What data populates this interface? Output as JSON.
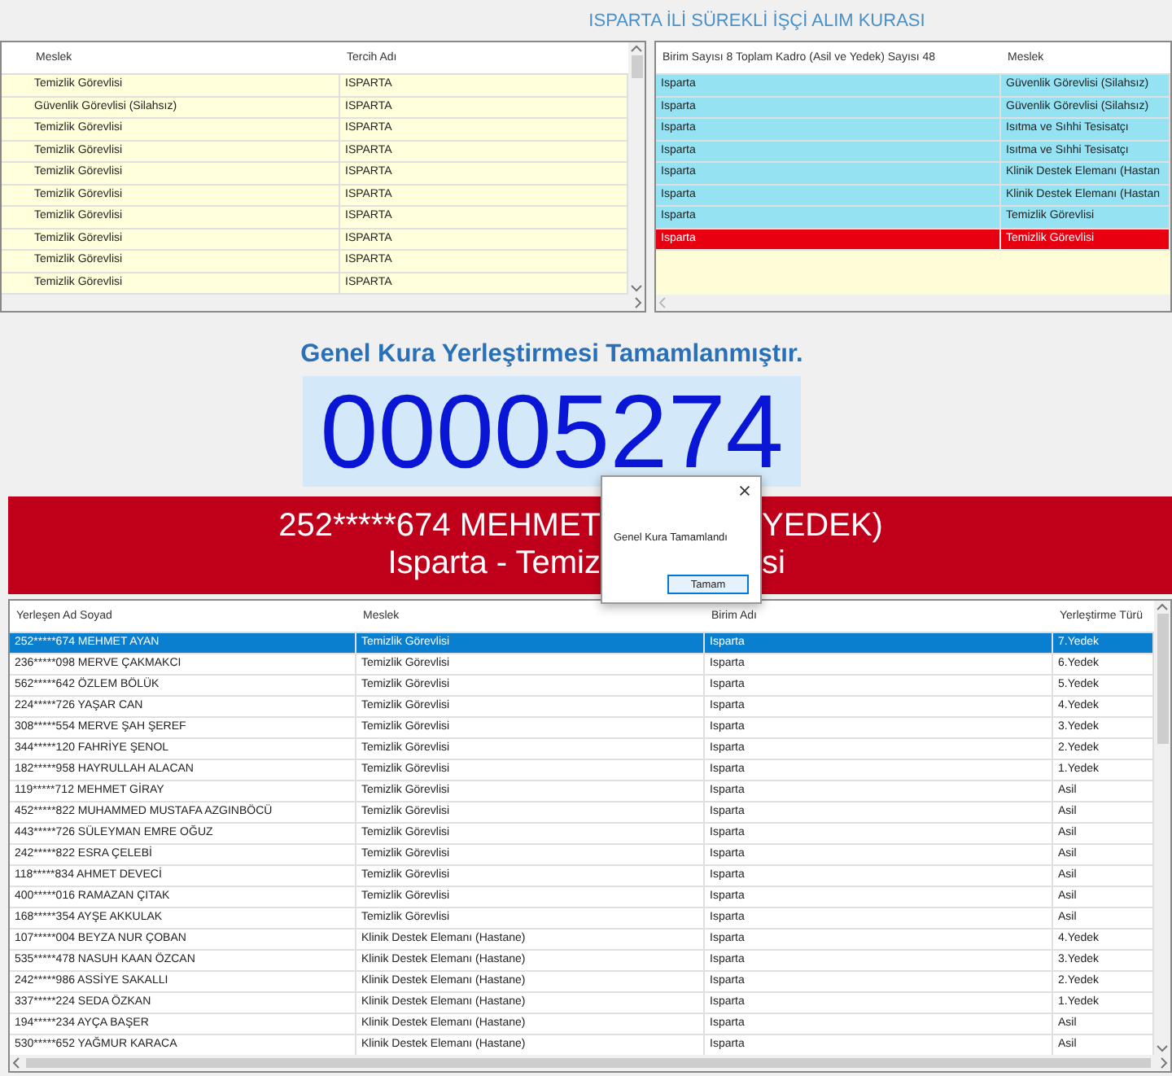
{
  "title": "ISPARTA İLİ SÜREKLİ İŞÇİ ALIM KURASI",
  "preferences_table": {
    "columns": [
      "Meslek",
      "Tercih Adı"
    ],
    "rows": [
      [
        "Temizlik Görevlisi",
        "ISPARTA"
      ],
      [
        "Güvenlik Görevlisi (Silahsız)",
        "ISPARTA"
      ],
      [
        "Temizlik Görevlisi",
        "ISPARTA"
      ],
      [
        "Temizlik Görevlisi",
        "ISPARTA"
      ],
      [
        "Temizlik Görevlisi",
        "ISPARTA"
      ],
      [
        "Temizlik Görevlisi",
        "ISPARTA"
      ],
      [
        "Temizlik Görevlisi",
        "ISPARTA"
      ],
      [
        "Temizlik Görevlisi",
        "ISPARTA"
      ],
      [
        "Temizlik Görevlisi",
        "ISPARTA"
      ],
      [
        "Temizlik Görevlisi",
        "ISPARTA"
      ]
    ]
  },
  "units_table": {
    "columns": [
      "Birim Sayısı 8 Toplam Kadro (Asil ve Yedek) Sayısı 48",
      "Meslek"
    ],
    "rows": [
      {
        "cells": [
          "Isparta",
          "Güvenlik Görevlisi (Silahsız)"
        ],
        "highlighted": false
      },
      {
        "cells": [
          "Isparta",
          "Güvenlik Görevlisi (Silahsız)"
        ],
        "highlighted": false
      },
      {
        "cells": [
          "Isparta",
          "Isıtma ve Sıhhi Tesisatçı"
        ],
        "highlighted": false
      },
      {
        "cells": [
          "Isparta",
          "Isıtma ve Sıhhi Tesisatçı"
        ],
        "highlighted": false
      },
      {
        "cells": [
          "Isparta",
          "Klinik Destek Elemanı (Hastan"
        ],
        "highlighted": false
      },
      {
        "cells": [
          "Isparta",
          "Klinik Destek Elemanı (Hastan"
        ],
        "highlighted": false
      },
      {
        "cells": [
          "Isparta",
          "Temizlik Görevlisi"
        ],
        "highlighted": false
      },
      {
        "cells": [
          "Isparta",
          "Temizlik Görevlisi"
        ],
        "highlighted": true
      }
    ]
  },
  "status": {
    "heading": "Genel Kura Yerleştirmesi Tamamlanmıştır.",
    "number": "00005274",
    "banner_lines": [
      [
        "252*****674 MEHMET",
        "YEDEK)"
      ],
      [
        "Isparta - Temiz",
        "si"
      ]
    ]
  },
  "dialog": {
    "message": "Genel Kura Tamamlandı",
    "button": "Tamam"
  },
  "results_table": {
    "columns": [
      "Yerleşen Ad Soyad",
      "Meslek",
      "Birim Adı",
      "Yerleştirme Türü"
    ],
    "rows": [
      {
        "cells": [
          "252*****674 MEHMET AYAN",
          "Temizlik Görevlisi",
          "Isparta",
          "7.Yedek"
        ],
        "selected": true
      },
      {
        "cells": [
          "236*****098 MERVE ÇAKMAKCI",
          "Temizlik Görevlisi",
          "Isparta",
          "6.Yedek"
        ],
        "selected": false
      },
      {
        "cells": [
          "562*****642 ÖZLEM BÖLÜK",
          "Temizlik Görevlisi",
          "Isparta",
          "5.Yedek"
        ],
        "selected": false
      },
      {
        "cells": [
          "224*****726 YAŞAR CAN",
          "Temizlik Görevlisi",
          "Isparta",
          "4.Yedek"
        ],
        "selected": false
      },
      {
        "cells": [
          "308*****554 MERVE ŞAH ŞEREF",
          "Temizlik Görevlisi",
          "Isparta",
          "3.Yedek"
        ],
        "selected": false
      },
      {
        "cells": [
          "344*****120 FAHRİYE ŞENOL",
          "Temizlik Görevlisi",
          "Isparta",
          "2.Yedek"
        ],
        "selected": false
      },
      {
        "cells": [
          "182*****958 HAYRULLAH ALACAN",
          "Temizlik Görevlisi",
          "Isparta",
          "1.Yedek"
        ],
        "selected": false
      },
      {
        "cells": [
          "119*****712 MEHMET GİRAY",
          "Temizlik Görevlisi",
          "Isparta",
          "Asil"
        ],
        "selected": false
      },
      {
        "cells": [
          "452*****822 MUHAMMED MUSTAFA AZGINBÖCÜ",
          "Temizlik Görevlisi",
          "Isparta",
          "Asil"
        ],
        "selected": false
      },
      {
        "cells": [
          "443*****726 SÜLEYMAN EMRE OĞUZ",
          "Temizlik Görevlisi",
          "Isparta",
          "Asil"
        ],
        "selected": false
      },
      {
        "cells": [
          "242*****822 ESRA ÇELEBİ",
          "Temizlik Görevlisi",
          "Isparta",
          "Asil"
        ],
        "selected": false
      },
      {
        "cells": [
          "118*****834 AHMET DEVECİ",
          "Temizlik Görevlisi",
          "Isparta",
          "Asil"
        ],
        "selected": false
      },
      {
        "cells": [
          "400*****016 RAMAZAN ÇITAK",
          "Temizlik Görevlisi",
          "Isparta",
          "Asil"
        ],
        "selected": false
      },
      {
        "cells": [
          "168*****354 AYŞE AKKULAK",
          "Temizlik Görevlisi",
          "Isparta",
          "Asil"
        ],
        "selected": false
      },
      {
        "cells": [
          "107*****004 BEYZA NUR ÇOBAN",
          "Klinik Destek Elemanı (Hastane)",
          "Isparta",
          "4.Yedek"
        ],
        "selected": false
      },
      {
        "cells": [
          "535*****478 NASUH KAAN ÖZCAN",
          "Klinik Destek Elemanı (Hastane)",
          "Isparta",
          "3.Yedek"
        ],
        "selected": false
      },
      {
        "cells": [
          "242*****986 ASSİYE SAKALLI",
          "Klinik Destek Elemanı (Hastane)",
          "Isparta",
          "2.Yedek"
        ],
        "selected": false
      },
      {
        "cells": [
          "337*****224 SEDA ÖZKAN",
          "Klinik Destek Elemanı (Hastane)",
          "Isparta",
          "1.Yedek"
        ],
        "selected": false
      },
      {
        "cells": [
          "194*****234 AYÇA BAŞER",
          "Klinik Destek Elemanı (Hastane)",
          "Isparta",
          "Asil"
        ],
        "selected": false
      },
      {
        "cells": [
          "530*****652 YAĞMUR KARACA",
          "Klinik Destek Elemanı (Hastane)",
          "Isparta",
          "Asil"
        ],
        "selected": false
      }
    ]
  }
}
